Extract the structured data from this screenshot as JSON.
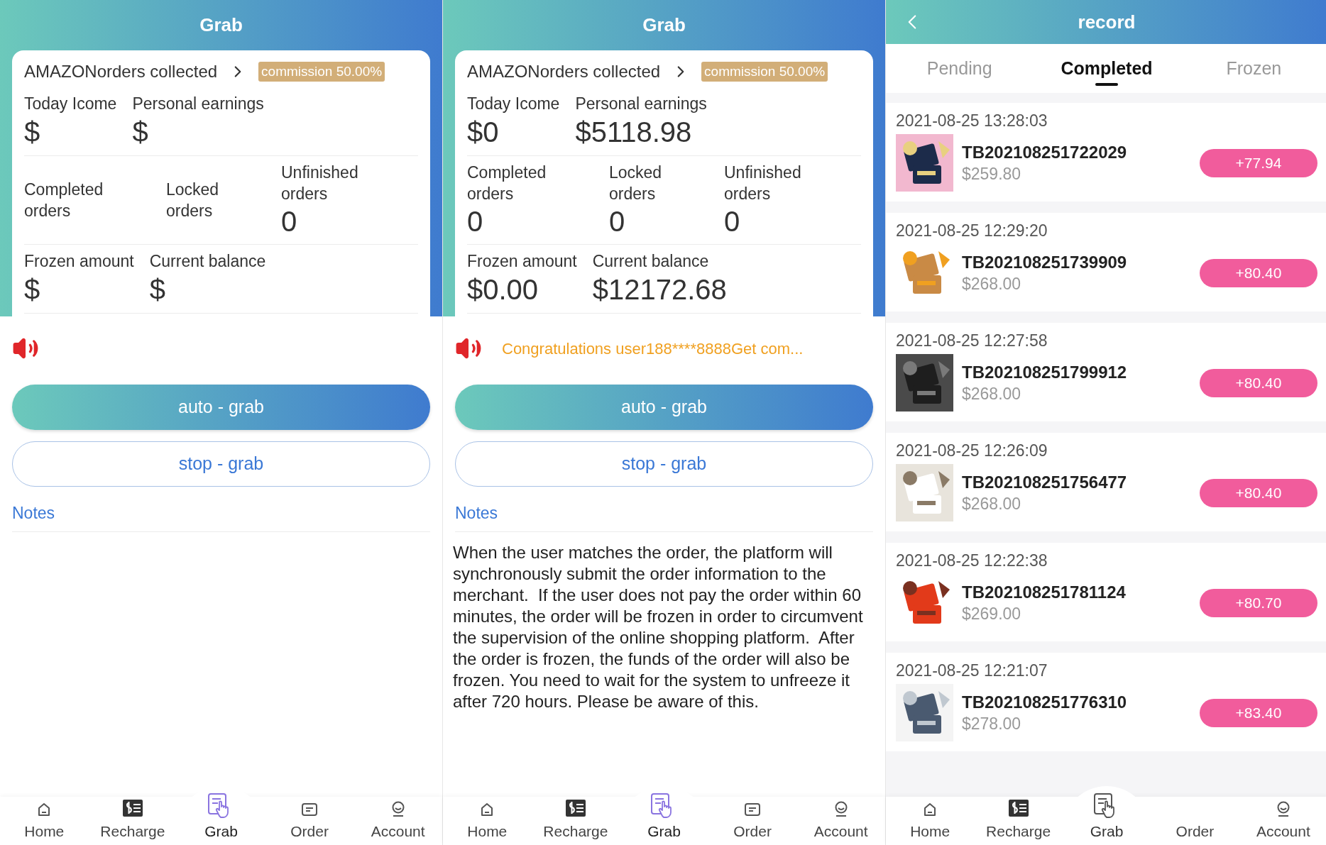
{
  "panels": [
    {
      "kind": "grab",
      "title": "Grab",
      "card": {
        "heading": "AMAZONorders collected",
        "badge": "commission 50.00%",
        "rows": [
          {
            "kind": "pair",
            "cells": [
              {
                "label": "Today Icome",
                "value": "$"
              },
              {
                "label": "Personal earnings",
                "value": "$"
              }
            ]
          },
          {
            "kind": "triple",
            "cells": [
              {
                "label": "Completed orders"
              },
              {
                "label": "Locked orders"
              },
              {
                "label": "Unfinished orders",
                "value": "0"
              }
            ]
          },
          {
            "kind": "pair",
            "cells": [
              {
                "label": "Frozen amount",
                "value": "$"
              },
              {
                "label": "Current balance",
                "value": "$"
              }
            ]
          }
        ]
      },
      "buttons": [
        {
          "kind": "primary",
          "label": "auto - grab"
        },
        {
          "kind": "outline",
          "label": "stop - grab"
        }
      ],
      "notes": {
        "title": "Notes"
      },
      "nav": [
        {
          "label": "Home",
          "selected": false,
          "icon_shown": true
        },
        {
          "label": "Recharge",
          "selected": false,
          "icon_shown": true
        },
        {
          "label": "Grab",
          "selected": true,
          "icon_shown": true
        },
        {
          "label": "Order",
          "selected": false,
          "icon_shown": true
        },
        {
          "label": "Account",
          "selected": false,
          "icon_shown": true
        }
      ]
    },
    {
      "kind": "grab",
      "title": "Grab",
      "card": {
        "heading": "AMAZONorders collected",
        "badge": "commission 50.00%",
        "rows": [
          {
            "kind": "pair",
            "cells": [
              {
                "label": "Today Icome",
                "value": "$0"
              },
              {
                "label": "Personal earnings",
                "value": "$5118.98"
              }
            ]
          },
          {
            "kind": "triple",
            "cells": [
              {
                "label": "Completed orders",
                "value": "0"
              },
              {
                "label": "Locked orders",
                "value": "0"
              },
              {
                "label": "Unfinished orders",
                "value": "0"
              }
            ]
          },
          {
            "kind": "pair",
            "cells": [
              {
                "label": "Frozen amount",
                "value": "$0.00"
              },
              {
                "label": "Current balance",
                "value": "$12172.68"
              }
            ]
          }
        ]
      },
      "notice": "Congratulations user188****8888Get com...",
      "buttons": [
        {
          "kind": "primary",
          "label": "auto - grab"
        },
        {
          "kind": "outline",
          "label": "stop - grab"
        }
      ],
      "notes": {
        "title": "Notes",
        "text": "When the user matches the order, the platform will synchronously submit the order information to the merchant.  If the user does not pay the order within 60  minutes, the order will be frozen in order to circumvent the supervision of the online shopping platform.  After the order is frozen, the funds of the order will also be frozen. You need to wait for the system to unfreeze it after 720 hours. Please be aware of this."
      },
      "nav": [
        {
          "label": "Home",
          "selected": false,
          "icon_shown": true
        },
        {
          "label": "Recharge",
          "selected": false,
          "icon_shown": true
        },
        {
          "label": "Grab",
          "selected": true,
          "icon_shown": true
        },
        {
          "label": "Order",
          "selected": false,
          "icon_shown": true
        },
        {
          "label": "Account",
          "selected": false,
          "icon_shown": true
        }
      ]
    },
    {
      "kind": "record",
      "title": "record",
      "tabs": [
        {
          "label": "Pending",
          "selected": false
        },
        {
          "label": "Completed",
          "selected": true
        },
        {
          "label": "Frozen",
          "selected": false
        }
      ],
      "orders": [
        {
          "time": "2021-08-25 13:28:03",
          "id": "TB202108251722029",
          "price": "$259.80",
          "amount": "+77.94"
        },
        {
          "time": "2021-08-25 12:29:20",
          "id": "TB202108251739909",
          "price": "$268.00",
          "amount": "+80.40"
        },
        {
          "time": "2021-08-25 12:27:58",
          "id": "TB202108251799912",
          "price": "$268.00",
          "amount": "+80.40"
        },
        {
          "time": "2021-08-25 12:26:09",
          "id": "TB202108251756477",
          "price": "$268.00",
          "amount": "+80.40"
        },
        {
          "time": "2021-08-25 12:22:38",
          "id": "TB202108251781124",
          "price": "$269.00",
          "amount": "+80.70"
        },
        {
          "time": "2021-08-25 12:21:07",
          "id": "TB202108251776310",
          "price": "$278.00",
          "amount": "+83.40"
        }
      ],
      "nav": [
        {
          "label": "Home",
          "selected": false,
          "icon_shown": true
        },
        {
          "label": "Recharge",
          "selected": false,
          "icon_shown": true
        },
        {
          "label": "Grab",
          "selected": false,
          "icon_shown": true
        },
        {
          "label": "Order",
          "selected": false,
          "icon_shown": false
        },
        {
          "label": "Account",
          "selected": false,
          "icon_shown": true
        }
      ]
    }
  ]
}
